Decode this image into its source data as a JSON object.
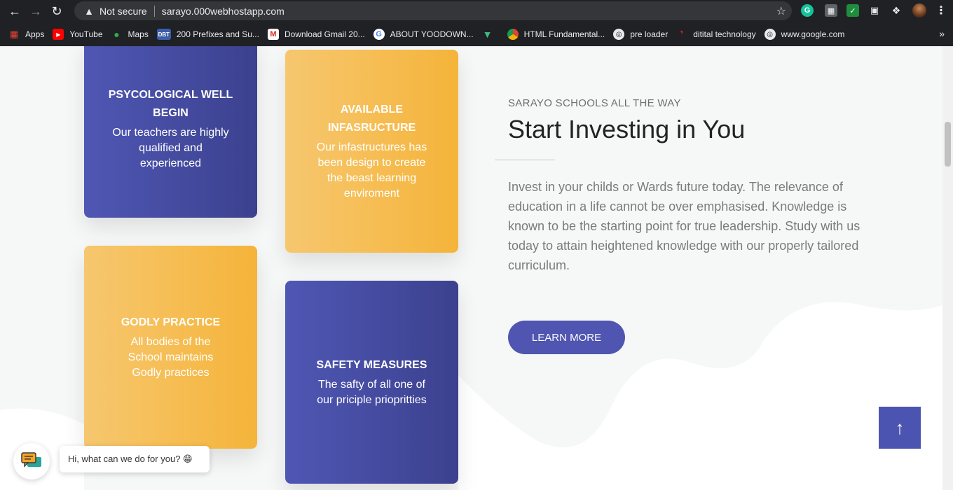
{
  "browser": {
    "security_label": "Not secure",
    "url": "sarayo.000webhostapp.com",
    "bookmarks": [
      {
        "label": "Apps",
        "icon": "apps-grid-icon",
        "color": "#ea4335"
      },
      {
        "label": "YouTube",
        "icon": "youtube-icon",
        "color": "#ff0000"
      },
      {
        "label": "Maps",
        "icon": "maps-pin-icon",
        "color": "#34a853"
      },
      {
        "label": "200 Prefixes and Su...",
        "icon": "dbt-icon",
        "color": "#3b5ea8"
      },
      {
        "label": "Download Gmail 20...",
        "icon": "gmail-icon",
        "color": "#d93025"
      },
      {
        "label": "ABOUT YOODOWN...",
        "icon": "google-g-icon",
        "color": "#4285f4"
      },
      {
        "label": "",
        "icon": "vue-logo-icon",
        "color": "#41b883"
      },
      {
        "label": "HTML Fundamental...",
        "icon": "chrome-icon",
        "color": "#db4437"
      },
      {
        "label": "pre loader",
        "icon": "globe-icon",
        "color": "#9aa0a6"
      },
      {
        "label": "ditital technology",
        "icon": "bookmark-red-icon",
        "color": "#c5221f"
      },
      {
        "label": "www.google.com",
        "icon": "globe-icon",
        "color": "#9aa0a6"
      }
    ],
    "more": "»"
  },
  "cards": [
    {
      "title": "PSYCOLOGICAL WELL BEGIN",
      "text": "Our teachers are highly qualified and experienced"
    },
    {
      "title": "AVAILABLE INFASRUCTURE",
      "text": "Our infastructures has been design to create the beast learning enviroment"
    },
    {
      "title": "GODLY PRACTICE",
      "text": "All bodies of the School maintains Godly practices"
    },
    {
      "title": "SAFETY MEASURES",
      "text": "The safty of all one of our priciple priopritties"
    }
  ],
  "hero": {
    "eyebrow": "SARAYO SCHOOLS ALL THE WAY",
    "heading": "Start Investing in You",
    "paragraph": "Invest in your childs or Wards future today. The relevance of education in a life cannot be over emphasised. Knowledge is known to be the starting point for true leadership. Study with us today to attain heightened knowledge with our properly tailored curriculum.",
    "button_label": "LEARN MORE"
  },
  "chat": {
    "message": "Hi, what can we do for you? 😁"
  },
  "colors": {
    "brand_blue": "#4f55b0",
    "brand_yellow": "#f5b43a",
    "chrome_bg": "#202124"
  }
}
